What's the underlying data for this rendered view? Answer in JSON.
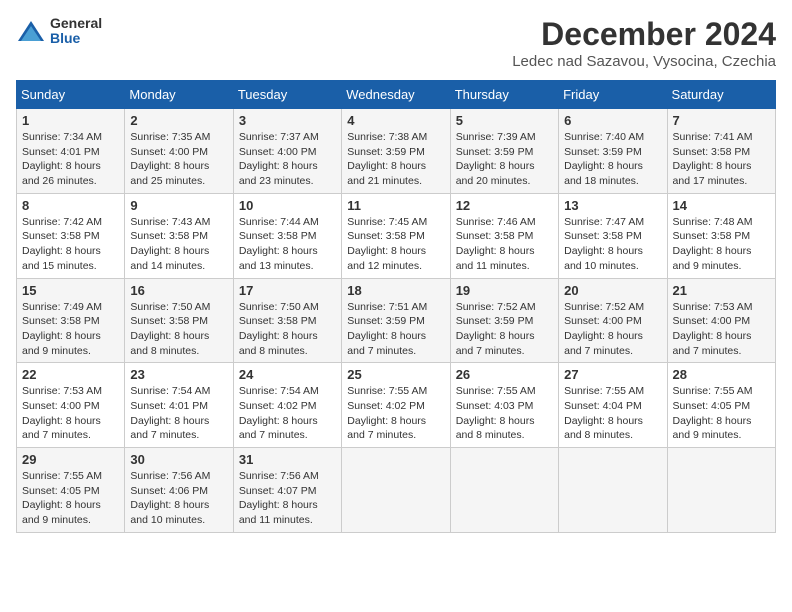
{
  "header": {
    "logo_general": "General",
    "logo_blue": "Blue",
    "month_title": "December 2024",
    "location": "Ledec nad Sazavou, Vysocina, Czechia"
  },
  "days_of_week": [
    "Sunday",
    "Monday",
    "Tuesday",
    "Wednesday",
    "Thursday",
    "Friday",
    "Saturday"
  ],
  "weeks": [
    [
      {
        "day": 1,
        "sunrise": "7:34 AM",
        "sunset": "4:01 PM",
        "daylight": "8 hours and 26 minutes."
      },
      {
        "day": 2,
        "sunrise": "7:35 AM",
        "sunset": "4:00 PM",
        "daylight": "8 hours and 25 minutes."
      },
      {
        "day": 3,
        "sunrise": "7:37 AM",
        "sunset": "4:00 PM",
        "daylight": "8 hours and 23 minutes."
      },
      {
        "day": 4,
        "sunrise": "7:38 AM",
        "sunset": "3:59 PM",
        "daylight": "8 hours and 21 minutes."
      },
      {
        "day": 5,
        "sunrise": "7:39 AM",
        "sunset": "3:59 PM",
        "daylight": "8 hours and 20 minutes."
      },
      {
        "day": 6,
        "sunrise": "7:40 AM",
        "sunset": "3:59 PM",
        "daylight": "8 hours and 18 minutes."
      },
      {
        "day": 7,
        "sunrise": "7:41 AM",
        "sunset": "3:58 PM",
        "daylight": "8 hours and 17 minutes."
      }
    ],
    [
      {
        "day": 8,
        "sunrise": "7:42 AM",
        "sunset": "3:58 PM",
        "daylight": "8 hours and 15 minutes."
      },
      {
        "day": 9,
        "sunrise": "7:43 AM",
        "sunset": "3:58 PM",
        "daylight": "8 hours and 14 minutes."
      },
      {
        "day": 10,
        "sunrise": "7:44 AM",
        "sunset": "3:58 PM",
        "daylight": "8 hours and 13 minutes."
      },
      {
        "day": 11,
        "sunrise": "7:45 AM",
        "sunset": "3:58 PM",
        "daylight": "8 hours and 12 minutes."
      },
      {
        "day": 12,
        "sunrise": "7:46 AM",
        "sunset": "3:58 PM",
        "daylight": "8 hours and 11 minutes."
      },
      {
        "day": 13,
        "sunrise": "7:47 AM",
        "sunset": "3:58 PM",
        "daylight": "8 hours and 10 minutes."
      },
      {
        "day": 14,
        "sunrise": "7:48 AM",
        "sunset": "3:58 PM",
        "daylight": "8 hours and 9 minutes."
      }
    ],
    [
      {
        "day": 15,
        "sunrise": "7:49 AM",
        "sunset": "3:58 PM",
        "daylight": "8 hours and 9 minutes."
      },
      {
        "day": 16,
        "sunrise": "7:50 AM",
        "sunset": "3:58 PM",
        "daylight": "8 hours and 8 minutes."
      },
      {
        "day": 17,
        "sunrise": "7:50 AM",
        "sunset": "3:58 PM",
        "daylight": "8 hours and 8 minutes."
      },
      {
        "day": 18,
        "sunrise": "7:51 AM",
        "sunset": "3:59 PM",
        "daylight": "8 hours and 7 minutes."
      },
      {
        "day": 19,
        "sunrise": "7:52 AM",
        "sunset": "3:59 PM",
        "daylight": "8 hours and 7 minutes."
      },
      {
        "day": 20,
        "sunrise": "7:52 AM",
        "sunset": "4:00 PM",
        "daylight": "8 hours and 7 minutes."
      },
      {
        "day": 21,
        "sunrise": "7:53 AM",
        "sunset": "4:00 PM",
        "daylight": "8 hours and 7 minutes."
      }
    ],
    [
      {
        "day": 22,
        "sunrise": "7:53 AM",
        "sunset": "4:00 PM",
        "daylight": "8 hours and 7 minutes."
      },
      {
        "day": 23,
        "sunrise": "7:54 AM",
        "sunset": "4:01 PM",
        "daylight": "8 hours and 7 minutes."
      },
      {
        "day": 24,
        "sunrise": "7:54 AM",
        "sunset": "4:02 PM",
        "daylight": "8 hours and 7 minutes."
      },
      {
        "day": 25,
        "sunrise": "7:55 AM",
        "sunset": "4:02 PM",
        "daylight": "8 hours and 7 minutes."
      },
      {
        "day": 26,
        "sunrise": "7:55 AM",
        "sunset": "4:03 PM",
        "daylight": "8 hours and 8 minutes."
      },
      {
        "day": 27,
        "sunrise": "7:55 AM",
        "sunset": "4:04 PM",
        "daylight": "8 hours and 8 minutes."
      },
      {
        "day": 28,
        "sunrise": "7:55 AM",
        "sunset": "4:05 PM",
        "daylight": "8 hours and 9 minutes."
      }
    ],
    [
      {
        "day": 29,
        "sunrise": "7:55 AM",
        "sunset": "4:05 PM",
        "daylight": "8 hours and 9 minutes."
      },
      {
        "day": 30,
        "sunrise": "7:56 AM",
        "sunset": "4:06 PM",
        "daylight": "8 hours and 10 minutes."
      },
      {
        "day": 31,
        "sunrise": "7:56 AM",
        "sunset": "4:07 PM",
        "daylight": "8 hours and 11 minutes."
      },
      null,
      null,
      null,
      null
    ]
  ],
  "labels": {
    "sunrise": "Sunrise:",
    "sunset": "Sunset:",
    "daylight": "Daylight:"
  }
}
